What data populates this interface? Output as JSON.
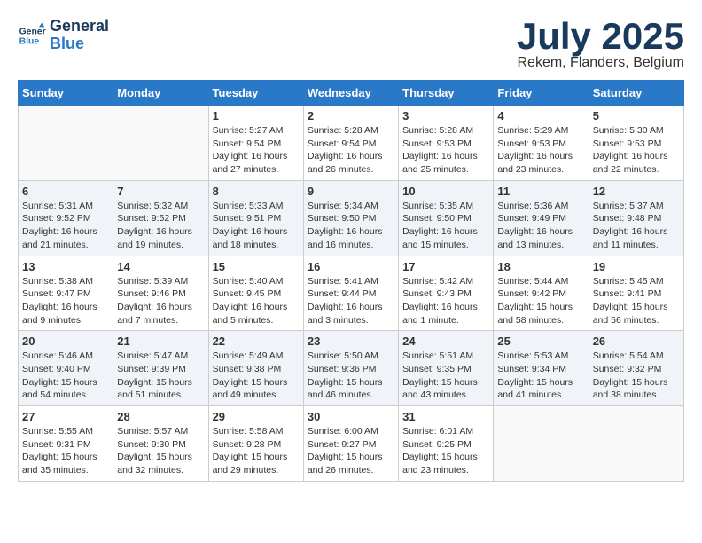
{
  "logo": {
    "line1": "General",
    "line2": "Blue"
  },
  "title": "July 2025",
  "subtitle": "Rekem, Flanders, Belgium",
  "weekdays": [
    "Sunday",
    "Monday",
    "Tuesday",
    "Wednesday",
    "Thursday",
    "Friday",
    "Saturday"
  ],
  "weeks": [
    [
      {
        "day": "",
        "info": ""
      },
      {
        "day": "",
        "info": ""
      },
      {
        "day": "1",
        "info": "Sunrise: 5:27 AM\nSunset: 9:54 PM\nDaylight: 16 hours\nand 27 minutes."
      },
      {
        "day": "2",
        "info": "Sunrise: 5:28 AM\nSunset: 9:54 PM\nDaylight: 16 hours\nand 26 minutes."
      },
      {
        "day": "3",
        "info": "Sunrise: 5:28 AM\nSunset: 9:53 PM\nDaylight: 16 hours\nand 25 minutes."
      },
      {
        "day": "4",
        "info": "Sunrise: 5:29 AM\nSunset: 9:53 PM\nDaylight: 16 hours\nand 23 minutes."
      },
      {
        "day": "5",
        "info": "Sunrise: 5:30 AM\nSunset: 9:53 PM\nDaylight: 16 hours\nand 22 minutes."
      }
    ],
    [
      {
        "day": "6",
        "info": "Sunrise: 5:31 AM\nSunset: 9:52 PM\nDaylight: 16 hours\nand 21 minutes."
      },
      {
        "day": "7",
        "info": "Sunrise: 5:32 AM\nSunset: 9:52 PM\nDaylight: 16 hours\nand 19 minutes."
      },
      {
        "day": "8",
        "info": "Sunrise: 5:33 AM\nSunset: 9:51 PM\nDaylight: 16 hours\nand 18 minutes."
      },
      {
        "day": "9",
        "info": "Sunrise: 5:34 AM\nSunset: 9:50 PM\nDaylight: 16 hours\nand 16 minutes."
      },
      {
        "day": "10",
        "info": "Sunrise: 5:35 AM\nSunset: 9:50 PM\nDaylight: 16 hours\nand 15 minutes."
      },
      {
        "day": "11",
        "info": "Sunrise: 5:36 AM\nSunset: 9:49 PM\nDaylight: 16 hours\nand 13 minutes."
      },
      {
        "day": "12",
        "info": "Sunrise: 5:37 AM\nSunset: 9:48 PM\nDaylight: 16 hours\nand 11 minutes."
      }
    ],
    [
      {
        "day": "13",
        "info": "Sunrise: 5:38 AM\nSunset: 9:47 PM\nDaylight: 16 hours\nand 9 minutes."
      },
      {
        "day": "14",
        "info": "Sunrise: 5:39 AM\nSunset: 9:46 PM\nDaylight: 16 hours\nand 7 minutes."
      },
      {
        "day": "15",
        "info": "Sunrise: 5:40 AM\nSunset: 9:45 PM\nDaylight: 16 hours\nand 5 minutes."
      },
      {
        "day": "16",
        "info": "Sunrise: 5:41 AM\nSunset: 9:44 PM\nDaylight: 16 hours\nand 3 minutes."
      },
      {
        "day": "17",
        "info": "Sunrise: 5:42 AM\nSunset: 9:43 PM\nDaylight: 16 hours\nand 1 minute."
      },
      {
        "day": "18",
        "info": "Sunrise: 5:44 AM\nSunset: 9:42 PM\nDaylight: 15 hours\nand 58 minutes."
      },
      {
        "day": "19",
        "info": "Sunrise: 5:45 AM\nSunset: 9:41 PM\nDaylight: 15 hours\nand 56 minutes."
      }
    ],
    [
      {
        "day": "20",
        "info": "Sunrise: 5:46 AM\nSunset: 9:40 PM\nDaylight: 15 hours\nand 54 minutes."
      },
      {
        "day": "21",
        "info": "Sunrise: 5:47 AM\nSunset: 9:39 PM\nDaylight: 15 hours\nand 51 minutes."
      },
      {
        "day": "22",
        "info": "Sunrise: 5:49 AM\nSunset: 9:38 PM\nDaylight: 15 hours\nand 49 minutes."
      },
      {
        "day": "23",
        "info": "Sunrise: 5:50 AM\nSunset: 9:36 PM\nDaylight: 15 hours\nand 46 minutes."
      },
      {
        "day": "24",
        "info": "Sunrise: 5:51 AM\nSunset: 9:35 PM\nDaylight: 15 hours\nand 43 minutes."
      },
      {
        "day": "25",
        "info": "Sunrise: 5:53 AM\nSunset: 9:34 PM\nDaylight: 15 hours\nand 41 minutes."
      },
      {
        "day": "26",
        "info": "Sunrise: 5:54 AM\nSunset: 9:32 PM\nDaylight: 15 hours\nand 38 minutes."
      }
    ],
    [
      {
        "day": "27",
        "info": "Sunrise: 5:55 AM\nSunset: 9:31 PM\nDaylight: 15 hours\nand 35 minutes."
      },
      {
        "day": "28",
        "info": "Sunrise: 5:57 AM\nSunset: 9:30 PM\nDaylight: 15 hours\nand 32 minutes."
      },
      {
        "day": "29",
        "info": "Sunrise: 5:58 AM\nSunset: 9:28 PM\nDaylight: 15 hours\nand 29 minutes."
      },
      {
        "day": "30",
        "info": "Sunrise: 6:00 AM\nSunset: 9:27 PM\nDaylight: 15 hours\nand 26 minutes."
      },
      {
        "day": "31",
        "info": "Sunrise: 6:01 AM\nSunset: 9:25 PM\nDaylight: 15 hours\nand 23 minutes."
      },
      {
        "day": "",
        "info": ""
      },
      {
        "day": "",
        "info": ""
      }
    ]
  ]
}
